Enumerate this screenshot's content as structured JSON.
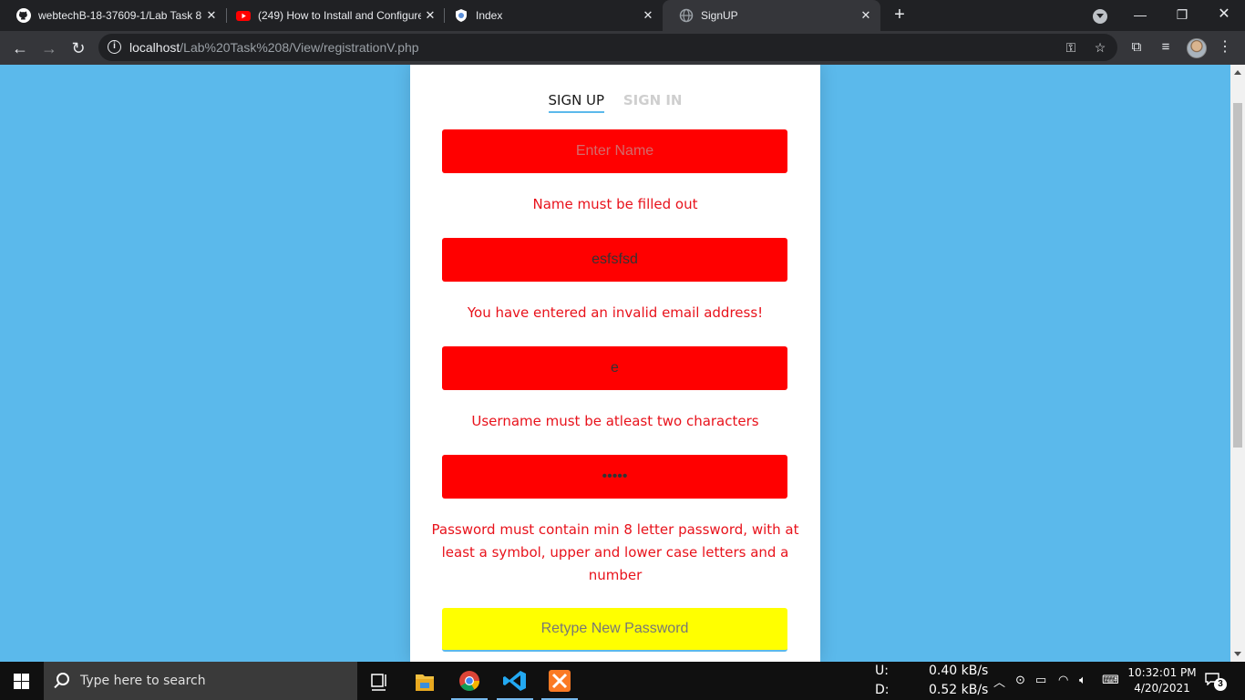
{
  "browser": {
    "tabs": [
      {
        "title": "webtechB-18-37609-1/Lab Task 8",
        "icon": "github-icon"
      },
      {
        "title": "(249) How to Install and Configure",
        "icon": "youtube-icon"
      },
      {
        "title": "Index",
        "icon": "shield-globe-icon"
      },
      {
        "title": "SignUP",
        "icon": "globe-icon",
        "active": true
      }
    ],
    "url_host": "localhost",
    "url_path": "/Lab%20Task%208/View/registrationV.php"
  },
  "auth": {
    "signup_tab": "SIGN UP",
    "signin_tab": "SIGN IN",
    "active_tab": "SIGN UP"
  },
  "form": {
    "name": {
      "value": "",
      "placeholder": "Enter Name",
      "error": "Name must be filled out"
    },
    "email": {
      "value": "esfsfsd",
      "error": "You have entered an invalid email address!"
    },
    "username": {
      "value": "e",
      "error": "Username must be atleast two characters"
    },
    "password": {
      "value": "•••••",
      "error": "Password must contain min 8 letter password, with at least a symbol, upper and lower case letters and a number"
    },
    "retype": {
      "value": "",
      "placeholder": "Retype New Password"
    }
  },
  "colors": {
    "page_background": "#5bb9eb",
    "invalid_field": "#ff0000",
    "warning_field": "#ffff00",
    "error_text": "#e8121b"
  },
  "taskbar": {
    "search_placeholder": "Type here to search",
    "upload_label": "U:",
    "download_label": "D:",
    "upload_speed": "0.40 kB/s",
    "download_speed": "0.52 kB/s",
    "time": "10:32:01 PM",
    "date": "4/20/2021",
    "notification_count": "3",
    "pinned_apps": [
      "task-view",
      "file-explorer",
      "chrome",
      "vscode",
      "xampp"
    ]
  }
}
